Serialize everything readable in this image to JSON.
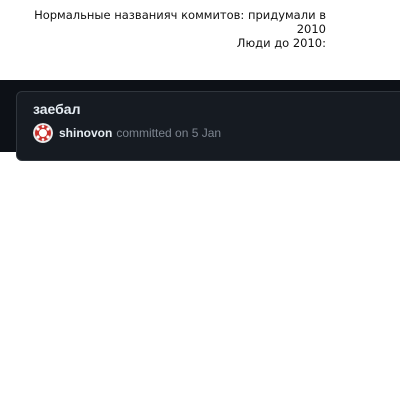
{
  "caption": {
    "line1": "Нормальные названияч коммитов: придумали в",
    "line2": "2010",
    "line3": "Люди до  2010:"
  },
  "commit": {
    "title": "заебал",
    "author": "shinovon",
    "committed_text": "committed on 5 Jan"
  },
  "colors": {
    "background": "#0d1117",
    "box": "#161b22",
    "text": "#e6edf3",
    "muted": "#7d8590"
  },
  "icons": {
    "avatar": "avatar-icon"
  }
}
